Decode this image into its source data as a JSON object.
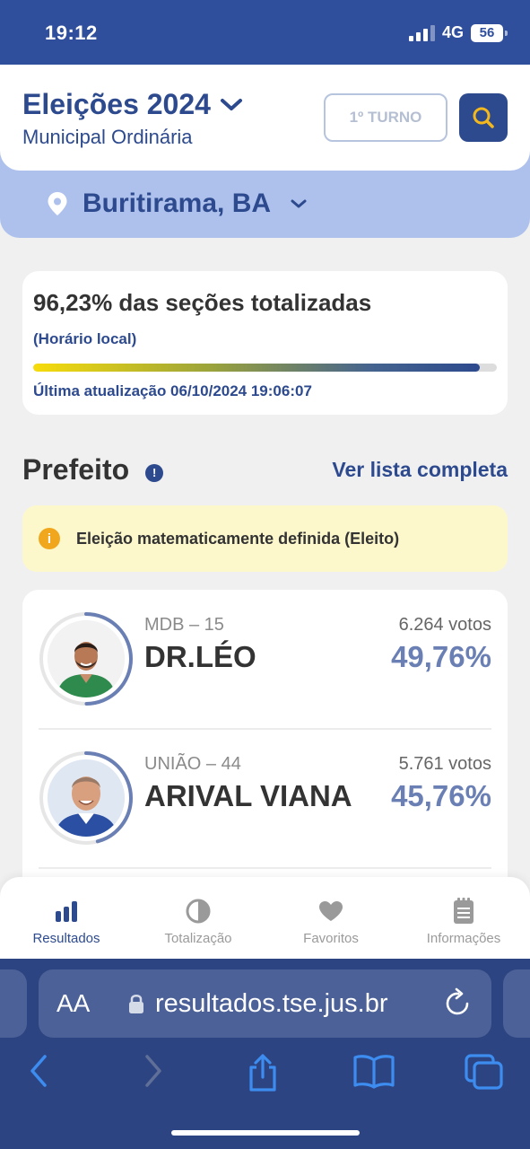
{
  "status": {
    "time": "19:12",
    "network": "4G",
    "battery": "56"
  },
  "header": {
    "title": "Eleições 2024",
    "subtitle": "Municipal Ordinária",
    "turno_label": "1º TURNO",
    "location": "Buritirama, BA"
  },
  "totalization": {
    "percent_text": "96,23% das seções totalizadas",
    "local_time": "(Horário local)",
    "progress": 0.9623,
    "last_update": "Última atualização 06/10/2024 19:06:07"
  },
  "section": {
    "title": "Prefeito",
    "see_all": "Ver lista completa",
    "alert": "Eleição matematicamente definida (Eleito)"
  },
  "candidates": [
    {
      "party": "MDB – 15",
      "name": "DR.LÉO",
      "votes": "6.264 votos",
      "percent": "49,76%",
      "share": 0.4976
    },
    {
      "party": "UNIÃO – 44",
      "name": "ARIVAL VIANA",
      "votes": "5.761 votos",
      "percent": "45,76%",
      "share": 0.4576
    }
  ],
  "tabs": [
    {
      "label": "Resultados",
      "icon": "bar-chart-icon"
    },
    {
      "label": "Totalização",
      "icon": "pie-icon"
    },
    {
      "label": "Favoritos",
      "icon": "heart-icon"
    },
    {
      "label": "Informações",
      "icon": "notepad-icon"
    }
  ],
  "browser": {
    "aa": "AA",
    "url": "resultados.tse.jus.br"
  },
  "colors": {
    "primary": "#2d4a8e",
    "accent_yellow": "#f7dc0b",
    "percent": "#6a7fb3"
  }
}
